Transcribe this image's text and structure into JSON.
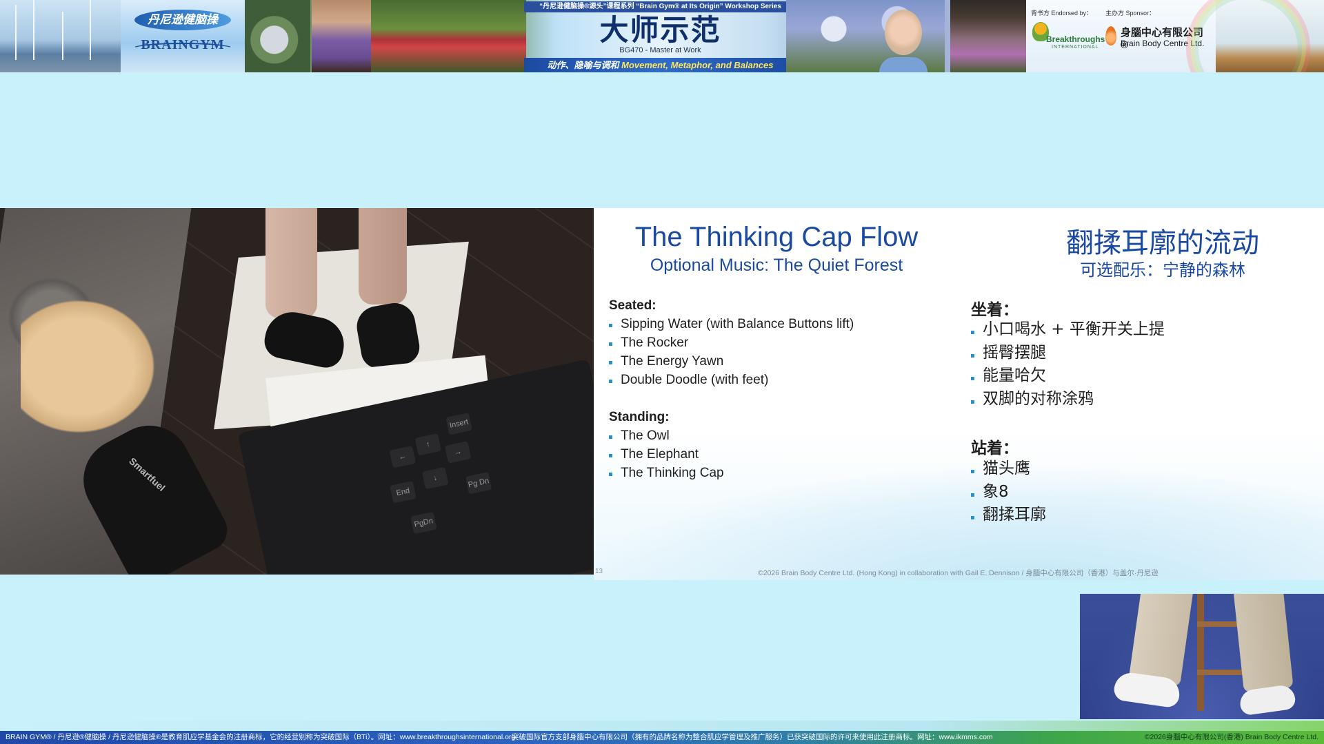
{
  "banner": {
    "logo_cn": "丹尼逊健脑操",
    "logo_en": "BRAINGYM",
    "series": "“丹尼逊健脑操®源头”课程系列 “Brain Gym® at Its Origin” Workshop Series",
    "title": "大师示范",
    "course": "BG470 - Master at Work",
    "subtitle_cn": "动作、隐喻与调和",
    "subtitle_en": "Movement, Metaphor, and Balances",
    "endorsed_label": "背书方 Endorsed by：",
    "sponsor_label": "主办方 Sponsor：",
    "bti_name": "Breakthroughs",
    "bti_sub": "INTERNATIONAL",
    "sponsor_cn": "身腦中心有限公司 ®",
    "sponsor_en": "Brain Body Centre Ltd."
  },
  "video": {
    "mouse_brand": "Smartfuel",
    "keys": [
      "Insert",
      "←",
      "↑",
      "→",
      "End",
      "↓",
      "PgDn",
      "Pg Dn"
    ]
  },
  "slide": {
    "title_en": "The Thinking Cap Flow",
    "subtitle_en": "Optional Music: The Quiet Forest",
    "title_cn": "翻揉耳廓的流动",
    "subtitle_cn": "可选配乐：宁静的森林",
    "seated_en": "Seated:",
    "seated_items_en": [
      "Sipping Water (with Balance Buttons lift)",
      "The Rocker",
      "The Energy Yawn",
      "Double Doodle (with feet)"
    ],
    "standing_en": "Standing:",
    "standing_items_en": [
      "The Owl",
      "The Elephant",
      "The Thinking Cap"
    ],
    "seated_cn": "坐着：",
    "seated_items_cn": [
      "小口喝水 + 平衡开关上提",
      "摇臀摆腿",
      "能量哈欠",
      "双脚的对称涂鸦"
    ],
    "standing_cn": "站着：",
    "standing_items_cn": [
      "猫头鹰",
      "象8",
      "翻揉耳廓"
    ],
    "page_number": "13",
    "copyright": "©2026 Brain Body Centre Ltd. (Hong Kong) in collaboration with Gail E. Dennison / 身腦中心有限公司（香港）与盖尔·丹尼逊"
  },
  "footer": {
    "left": "BRAIN GYM® / 丹尼逊®健脑操 / 丹尼逊健脑操®是教育肌应学基金会的注册商标，它的经营别称为突破国际（BTi）。网址：www.breakthroughsinternational.org",
    "middle": "突破国际官方支部身腦中心有限公司（拥有的品牌名称为整合肌应学管理及推广服务）已获突破国际的许可来使用此注册商标。网址：www.ikmms.com",
    "right": "©2026身腦中心有限公司(香港) Brain Body Centre Ltd."
  },
  "colors": {
    "background": "#c9f1fb",
    "slide_title": "#1a4aa0",
    "bullet": "#2a8ec9",
    "footer_start": "#1f49a8",
    "footer_end": "#5cbc3a"
  }
}
